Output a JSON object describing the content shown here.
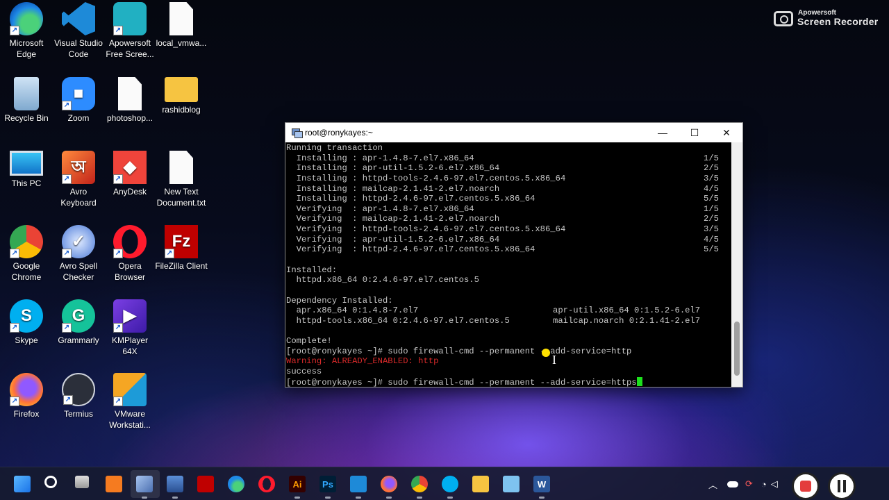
{
  "desktop": {
    "icons": [
      {
        "label": "Microsoft\nEdge",
        "icon": "edge-icon"
      },
      {
        "label": "Visual Studio\nCode",
        "icon": "vscode-icon"
      },
      {
        "label": "Apowersoft\nFree Scree...",
        "icon": "apowersoft-icon"
      },
      {
        "label": "local_vmwa...",
        "icon": "text-file-icon"
      },
      {
        "label": "Recycle Bin",
        "icon": "recycle-bin-icon"
      },
      {
        "label": "Zoom",
        "icon": "zoom-icon"
      },
      {
        "label": "photoshop...",
        "icon": "text-file-icon"
      },
      {
        "label": "rashidblog",
        "icon": "folder-icon"
      },
      {
        "label": "This PC",
        "icon": "monitor-icon"
      },
      {
        "label": "Avro\nKeyboard",
        "icon": "avro-keyboard-icon"
      },
      {
        "label": "AnyDesk",
        "icon": "anydesk-icon"
      },
      {
        "label": "New Text\nDocument.txt",
        "icon": "text-file-icon"
      },
      {
        "label": "Google\nChrome",
        "icon": "chrome-icon"
      },
      {
        "label": "Avro Spell\nChecker",
        "icon": "avro-spell-icon"
      },
      {
        "label": "Opera\nBrowser",
        "icon": "opera-icon"
      },
      {
        "label": "FileZilla Client",
        "icon": "filezilla-icon"
      },
      {
        "label": "Skype",
        "icon": "skype-icon"
      },
      {
        "label": "Grammarly",
        "icon": "grammarly-icon"
      },
      {
        "label": "KMPlayer\n64X",
        "icon": "kmplayer-icon"
      },
      {
        "label": "Firefox",
        "icon": "firefox-icon"
      },
      {
        "label": "Termius",
        "icon": "termius-icon"
      },
      {
        "label": "VMware\nWorkstati...",
        "icon": "vmware-icon"
      }
    ]
  },
  "recorder": {
    "brand_top": "Apowersoft",
    "brand_bottom": "Screen Recorder"
  },
  "terminal": {
    "title": "root@ronykayes:~",
    "minimize": "—",
    "maximize": "☐",
    "close": "✕",
    "lines": [
      {
        "text": "Running transaction"
      },
      {
        "text": "  Installing : apr-1.4.8-7.el7.x86_64",
        "right": "1/5"
      },
      {
        "text": "  Installing : apr-util-1.5.2-6.el7.x86_64",
        "right": "2/5"
      },
      {
        "text": "  Installing : httpd-tools-2.4.6-97.el7.centos.5.x86_64",
        "right": "3/5"
      },
      {
        "text": "  Installing : mailcap-2.1.41-2.el7.noarch",
        "right": "4/5"
      },
      {
        "text": "  Installing : httpd-2.4.6-97.el7.centos.5.x86_64",
        "right": "5/5"
      },
      {
        "text": "  Verifying  : apr-1.4.8-7.el7.x86_64",
        "right": "1/5"
      },
      {
        "text": "  Verifying  : mailcap-2.1.41-2.el7.noarch",
        "right": "2/5"
      },
      {
        "text": "  Verifying  : httpd-tools-2.4.6-97.el7.centos.5.x86_64",
        "right": "3/5"
      },
      {
        "text": "  Verifying  : apr-util-1.5.2-6.el7.x86_64",
        "right": "4/5"
      },
      {
        "text": "  Verifying  : httpd-2.4.6-97.el7.centos.5.x86_64",
        "right": "5/5"
      },
      {
        "text": ""
      },
      {
        "text": "Installed:"
      },
      {
        "text": "  httpd.x86_64 0:2.4.6-97.el7.centos.5"
      },
      {
        "text": ""
      },
      {
        "text": "Dependency Installed:"
      },
      {
        "text": "  apr.x86_64 0:1.4.8-7.el7",
        "col2": "apr-util.x86_64 0:1.5.2-6.el7"
      },
      {
        "text": "  httpd-tools.x86_64 0:2.4.6-97.el7.centos.5",
        "col2": "mailcap.noarch 0:2.1.41-2.el7"
      },
      {
        "text": ""
      },
      {
        "text": "Complete!"
      },
      {
        "text": "[root@ronykayes ~]# sudo firewall-cmd --permanent --add-service=http"
      },
      {
        "text": "Warning: ALREADY_ENABLED: http",
        "style": "red"
      },
      {
        "text": "success"
      },
      {
        "text": "[root@ronykayes ~]# sudo firewall-cmd --permanent --add-service=https",
        "cursor": true
      }
    ]
  },
  "taskbar": {
    "items": [
      {
        "icon": "start-icon"
      },
      {
        "icon": "search-icon"
      },
      {
        "icon": "task-view-icon"
      },
      {
        "icon": "xampp-icon"
      },
      {
        "icon": "putty-icon"
      },
      {
        "icon": "remote-desktop-icon"
      },
      {
        "icon": "filezilla-icon"
      },
      {
        "icon": "edge-icon"
      },
      {
        "icon": "opera-icon"
      },
      {
        "icon": "illustrator-icon"
      },
      {
        "icon": "photoshop-icon"
      },
      {
        "icon": "vscode-icon"
      },
      {
        "icon": "firefox-icon"
      },
      {
        "icon": "chrome-icon"
      },
      {
        "icon": "skype-icon"
      },
      {
        "icon": "file-explorer-icon"
      },
      {
        "icon": "notepad-icon"
      },
      {
        "icon": "word-icon"
      }
    ],
    "illustrator_label": "Ai",
    "photoshop_label": "Ps",
    "word_label": "W"
  }
}
